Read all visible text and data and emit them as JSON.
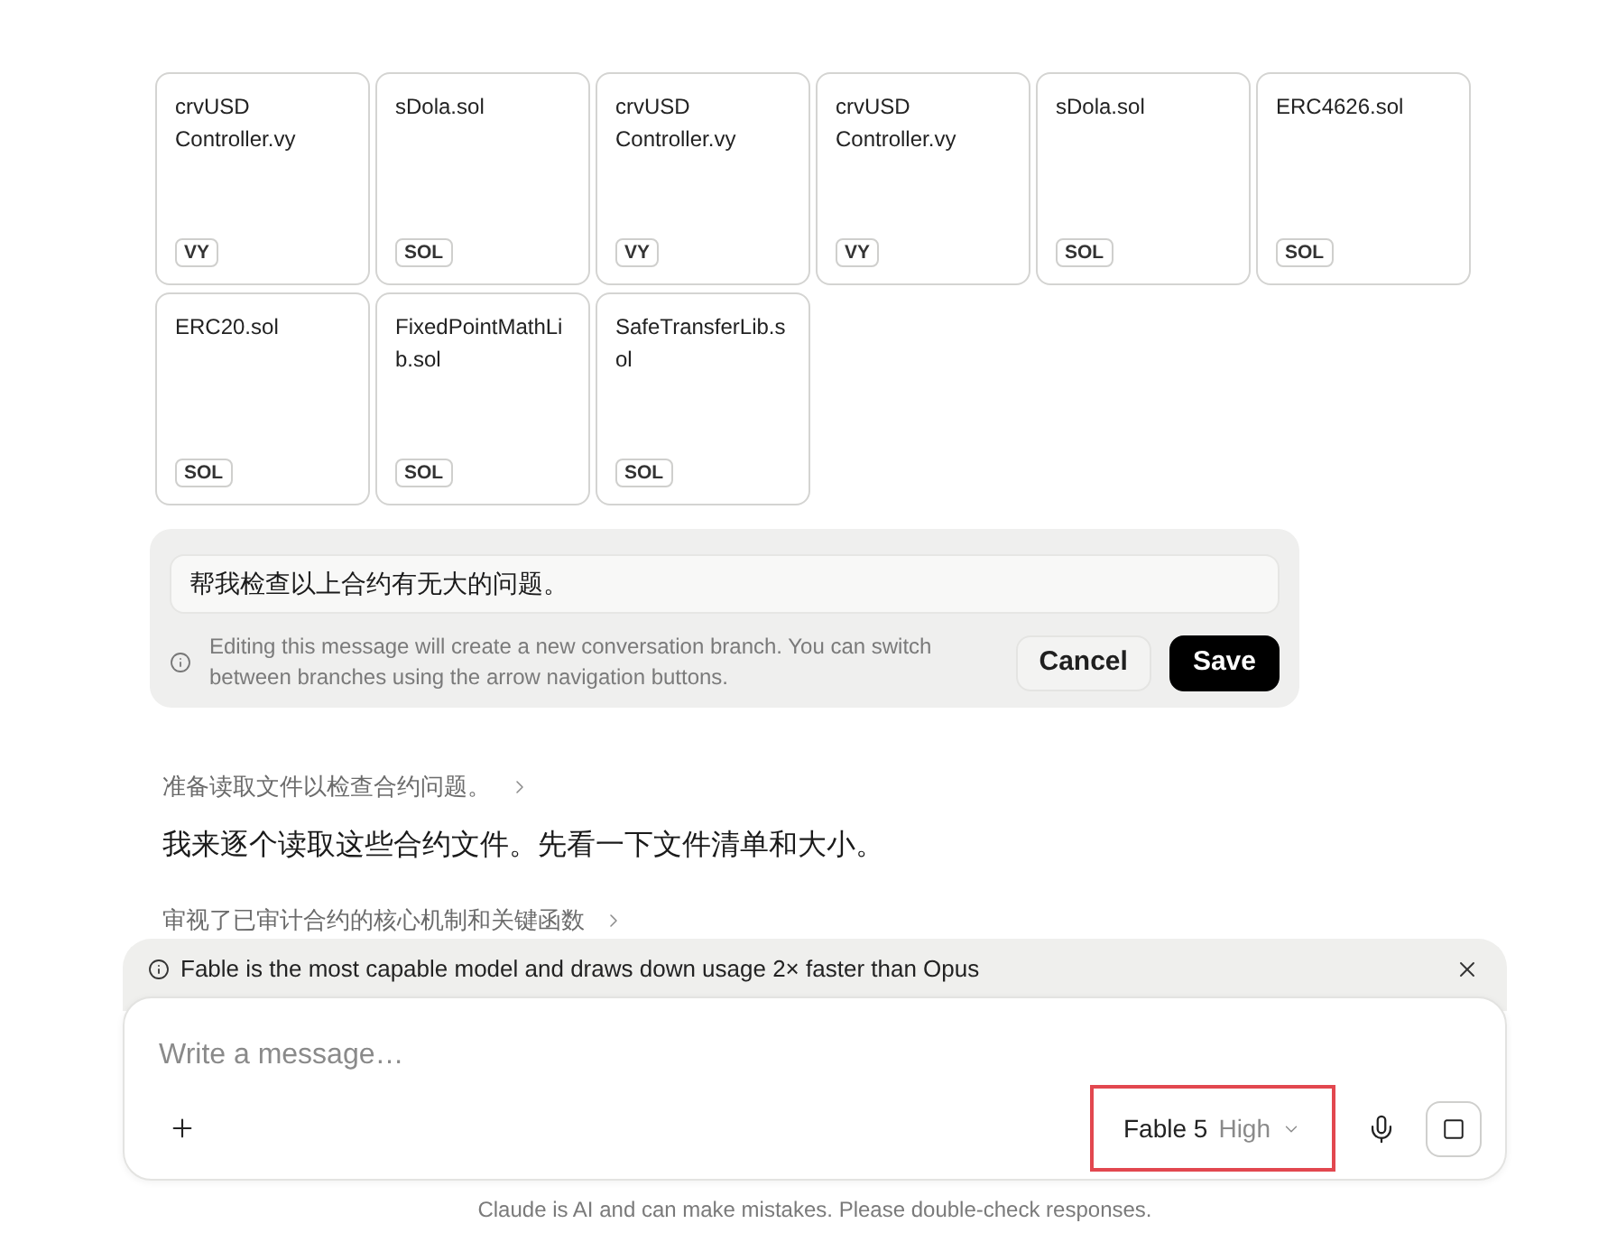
{
  "attachments": [
    {
      "name": "crvUSD Controller.vy",
      "type": "VY"
    },
    {
      "name": "sDola.sol",
      "type": "SOL"
    },
    {
      "name": "crvUSD Controller.vy",
      "type": "VY"
    },
    {
      "name": "crvUSD Controller.vy",
      "type": "VY"
    },
    {
      "name": "sDola.sol",
      "type": "SOL"
    },
    {
      "name": "ERC4626.sol",
      "type": "SOL"
    },
    {
      "name": "ERC20.sol",
      "type": "SOL"
    },
    {
      "name": "FixedPointMathLib.sol",
      "type": "SOL"
    },
    {
      "name": "SafeTransferLib.sol",
      "type": "SOL"
    }
  ],
  "edit_message": {
    "value": "帮我检查以上合约有无大的问题。",
    "notice": "Editing this message will create a new conversation branch. You can switch between branches using the arrow navigation buttons.",
    "buttons": [
      {
        "label": "Cancel",
        "kind": "secondary"
      },
      {
        "label": "Save",
        "kind": "primary"
      }
    ]
  },
  "response": [
    {
      "kind": "step",
      "text": "准备读取文件以检查合约问题。"
    },
    {
      "kind": "paragraph",
      "text": "我来逐个读取这些合约文件。先看一下文件清单和大小。"
    },
    {
      "kind": "step",
      "text": "审视了已审计合约的核心机制和关键函数"
    }
  ],
  "banner": {
    "text": "Fable is the most capable model and draws down usage 2× faster than Opus"
  },
  "composer": {
    "placeholder": "Write a message…",
    "model": "Fable 5",
    "effort": "High",
    "highlighted": true
  },
  "disclaimer": "Claude is AI and can make mistakes. Please double-check responses."
}
